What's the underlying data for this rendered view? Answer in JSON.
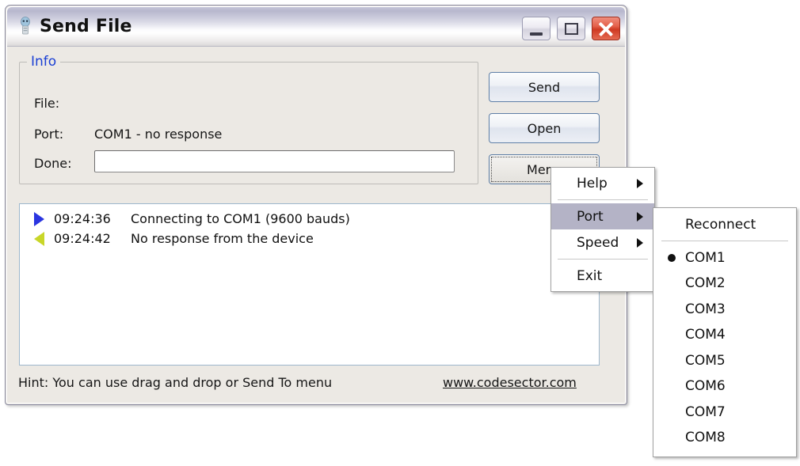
{
  "window": {
    "title": "Send File",
    "icon": "usb-plug-icon",
    "controls": {
      "minimize": "minimize-button",
      "maximize": "maximize-button",
      "close": "close-button"
    }
  },
  "info": {
    "legend": "Info",
    "file_label": "File:",
    "file_value": "",
    "port_label": "Port:",
    "port_value": "COM1 - no response",
    "done_label": "Done:",
    "done_value": "",
    "done_placeholder": ""
  },
  "actions": {
    "send": "Send",
    "open": "Open",
    "menu": "Menu"
  },
  "log": {
    "rows": [
      {
        "icon": "blue-right-triangle-icon",
        "time": "09:24:36",
        "message": "Connecting to COM1 (9600 bauds)"
      },
      {
        "icon": "yellow-left-triangle-icon",
        "time": "09:24:42",
        "message": "No response from the device"
      }
    ]
  },
  "status": {
    "hint": "Hint: You can use drag and drop or Send To menu",
    "link": "www.codesector.com"
  },
  "menu_main": {
    "items": [
      {
        "label": "Help",
        "submenu": true,
        "highlighted": false
      },
      {
        "separator": true
      },
      {
        "label": "Port",
        "submenu": true,
        "highlighted": true
      },
      {
        "label": "Speed",
        "submenu": true,
        "highlighted": false
      },
      {
        "separator": true
      },
      {
        "label": "Exit",
        "submenu": false,
        "highlighted": false
      }
    ]
  },
  "menu_sub": {
    "items": [
      {
        "label": "Reconnect",
        "selected": false
      },
      {
        "separator": true
      },
      {
        "label": "COM1",
        "selected": true
      },
      {
        "label": "COM2",
        "selected": false
      },
      {
        "label": "COM3",
        "selected": false
      },
      {
        "label": "COM4",
        "selected": false
      },
      {
        "label": "COM5",
        "selected": false
      },
      {
        "label": "COM6",
        "selected": false
      },
      {
        "label": "COM7",
        "selected": false
      },
      {
        "label": "COM8",
        "selected": false
      }
    ]
  },
  "colors": {
    "accent_blue": "#1a3fd4",
    "highlight": "#b4b3c6",
    "close_red": "#cf3a23",
    "window_face": "#ece9e4"
  }
}
